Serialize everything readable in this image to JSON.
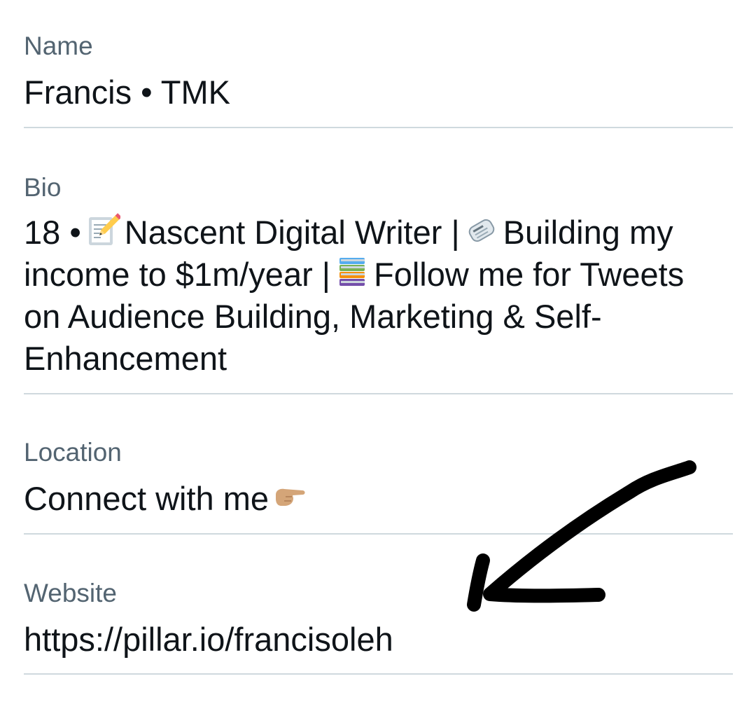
{
  "fields": {
    "name": {
      "label": "Name",
      "value": "Francis • TMK"
    },
    "bio": {
      "label": "Bio",
      "segments": [
        "18 •",
        "Nascent Digital Writer |",
        "Building my income to $1m/year |",
        "Follow me for Tweets on Audience Building, Marketing & Self-Enhancement"
      ],
      "icons": [
        "memo-icon",
        "newspaper-icon",
        "books-icon"
      ]
    },
    "location": {
      "label": "Location",
      "value": "Connect with me",
      "icon": "pointing-right-hand-icon"
    },
    "website": {
      "label": "Website",
      "value": "https://pillar.io/francisoleh"
    }
  },
  "annotation": {
    "icon": "hand-drawn-arrow-icon",
    "color": "#000000"
  },
  "colors": {
    "label": "#536471",
    "text": "#0f1419",
    "divider": "#cfd9de"
  }
}
